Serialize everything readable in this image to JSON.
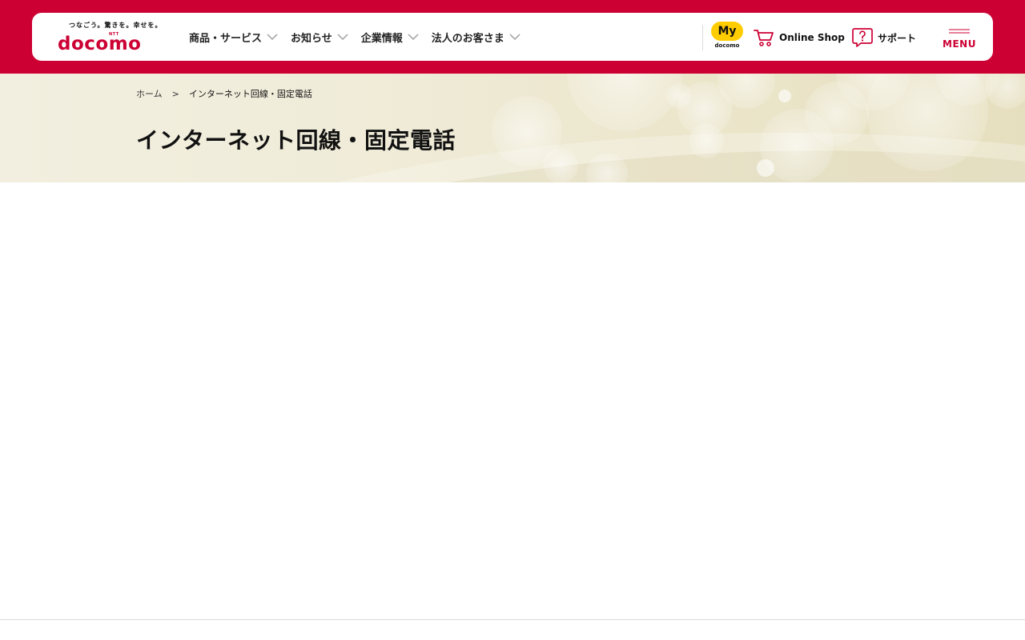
{
  "brand": {
    "tagline": "つなごう。驚きを。幸せを。",
    "ntt_mark": "NTT",
    "wordmark": "docomo",
    "accent_color": "#cc0033"
  },
  "nav": {
    "items": [
      {
        "label": "商品・サービス",
        "icon": "chevron-down-icon"
      },
      {
        "label": "お知らせ",
        "icon": "chevron-down-icon"
      },
      {
        "label": "企業情報",
        "icon": "chevron-down-icon"
      },
      {
        "label": "法人のお客さま",
        "icon": "chevron-down-icon"
      }
    ]
  },
  "utility": {
    "my_docomo_badge": "My",
    "my_docomo_sub": "docomo",
    "online_shop_label": "Online Shop",
    "online_shop_icon": "cart-icon",
    "support_label": "サポート",
    "support_icon": "question-bubble-icon",
    "menu_label": "MENU",
    "menu_icon": "hamburger-icon",
    "badge_color": "#ffcc00"
  },
  "breadcrumb": {
    "home": "ホーム",
    "separator": ">",
    "current": "インターネット回線・固定電話"
  },
  "page": {
    "title": "インターネット回線・固定電話"
  }
}
